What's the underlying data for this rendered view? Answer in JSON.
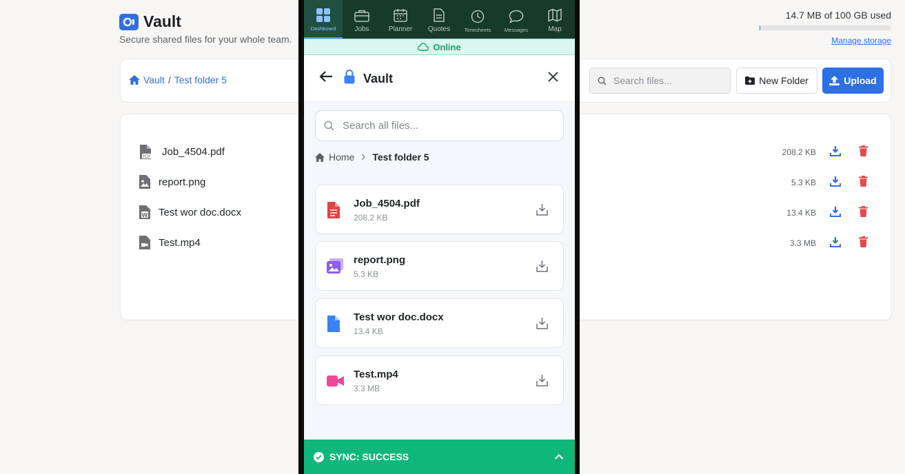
{
  "desktop": {
    "title": "Vault",
    "subtitle": "Secure shared files for your whole team.",
    "storage": {
      "text": "14.7 MB of 100 GB used",
      "link": "Manage storage",
      "used_fraction": 0.000147
    },
    "breadcrumb": {
      "root": "Vault",
      "sep": "/",
      "current": "Test folder 5"
    },
    "search_placeholder": "Search files...",
    "new_folder_label": "New Folder",
    "upload_label": "Upload",
    "files": [
      {
        "name": "Job_4504.pdf",
        "size": "208.2 KB",
        "icon": "pdf-file-icon"
      },
      {
        "name": "report.png",
        "size": "5.3 KB",
        "icon": "image-file-icon"
      },
      {
        "name": "Test wor doc.docx",
        "size": "13.4 KB",
        "icon": "word-file-icon"
      },
      {
        "name": "Test.mp4",
        "size": "3.3 MB",
        "icon": "video-file-icon"
      }
    ]
  },
  "mobile": {
    "nav": [
      {
        "label": "Dashboard",
        "icon": "grid-icon",
        "active": true
      },
      {
        "label": "Jobs",
        "icon": "briefcase-icon"
      },
      {
        "label": "Planner",
        "icon": "calendar-icon"
      },
      {
        "label": "Quotes",
        "icon": "document-icon"
      },
      {
        "label": "Timesheets",
        "icon": "clock-icon"
      },
      {
        "label": "Messages",
        "icon": "chat-icon"
      },
      {
        "label": "Map",
        "icon": "map-icon"
      }
    ],
    "online_label": "Online",
    "header_title": "Vault",
    "search_placeholder": "Search all files...",
    "breadcrumb": {
      "home": "Home",
      "current": "Test folder 5"
    },
    "files": [
      {
        "name": "Job_4504.pdf",
        "size": "208.2 KB",
        "icon": "pdf-icon",
        "color": "#e04545"
      },
      {
        "name": "report.png",
        "size": "5.3 KB",
        "icon": "image-icon",
        "color": "#8b5cf6"
      },
      {
        "name": "Test wor doc.docx",
        "size": "13.4 KB",
        "icon": "doc-icon",
        "color": "#3b82f6"
      },
      {
        "name": "Test.mp4",
        "size": "3.3 MB",
        "icon": "video-icon",
        "color": "#ec4899"
      }
    ],
    "sync_label": "SYNC: SUCCESS"
  },
  "colors": {
    "accent": "#2f6fe4",
    "delete": "#e5484d",
    "nav_bg": "#173a2b",
    "online": "#11a36b",
    "sync": "#10b77a"
  }
}
